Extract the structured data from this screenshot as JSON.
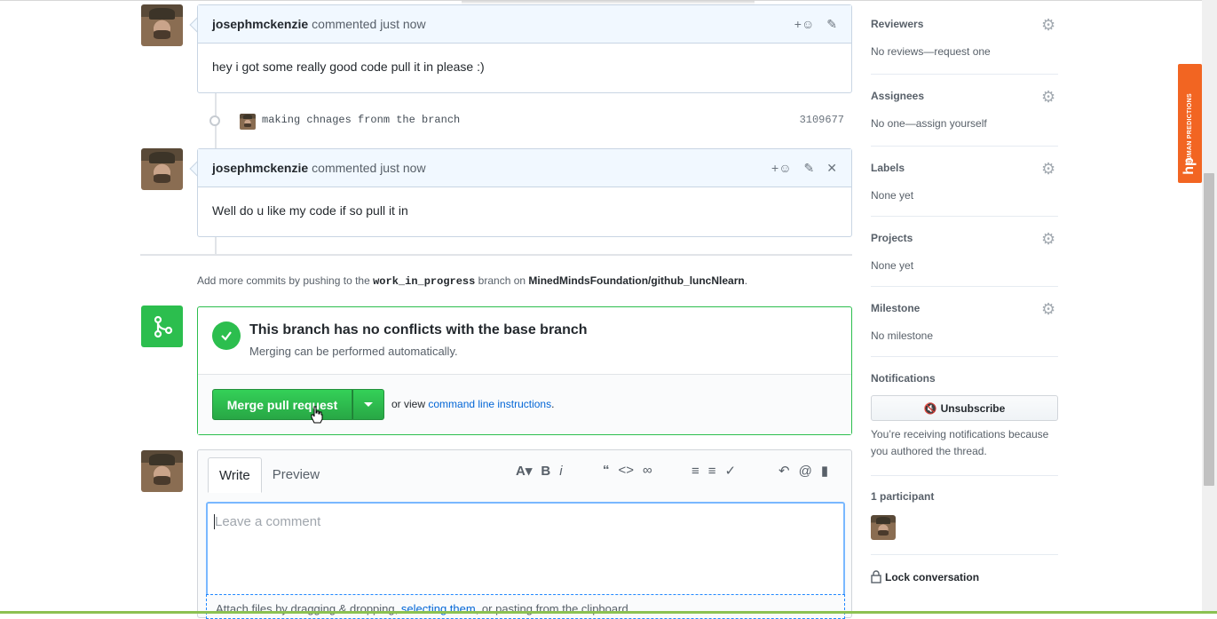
{
  "comments": [
    {
      "author": "josephmckenzie",
      "meta": "commented just now",
      "body": "hey i got some really good code pull it in please :)"
    },
    {
      "author": "josephmckenzie",
      "meta": "commented just now",
      "body": "Well do u like my code if so pull it in"
    }
  ],
  "commit": {
    "message": "making chnages fronm the branch",
    "sha": "3109677"
  },
  "addmore": {
    "prefix": "Add more commits by pushing to the",
    "branch": "work_in_progress",
    "middle": "branch on",
    "repo": "MinedMindsFoundation/github_luncNlearn",
    "suffix": "."
  },
  "merge": {
    "title": "This branch has no conflicts with the base branch",
    "subtitle": "Merging can be performed automatically.",
    "button": "Merge pull request",
    "or_view": "or view",
    "link": "command line instructions",
    "link_suffix": "."
  },
  "editor": {
    "tab_write": "Write",
    "tab_preview": "Preview",
    "placeholder": "Leave a comment",
    "attach_prefix": "Attach files by dragging & dropping,",
    "attach_link": "selecting them",
    "attach_suffix": ", or pasting from the clipboard."
  },
  "sidebar": {
    "reviewers": {
      "title": "Reviewers",
      "value": "No reviews—request one"
    },
    "assignees": {
      "title": "Assignees",
      "value": "No one—assign yourself"
    },
    "labels": {
      "title": "Labels",
      "value": "None yet"
    },
    "projects": {
      "title": "Projects",
      "value": "None yet"
    },
    "milestone": {
      "title": "Milestone",
      "value": "No milestone"
    },
    "notifications": {
      "title": "Notifications",
      "button": "Unsubscribe",
      "text": "You’re receiving notifications because you authored the thread."
    },
    "participants": {
      "title": "1 participant"
    },
    "lock": "Lock conversation"
  },
  "overlay": {
    "brand_small": "HUMAN PREDICTIONS",
    "brand_logo": "hp"
  },
  "colors": {
    "accent_green": "#2cbe4e",
    "link_blue": "#0366d6",
    "brand_orange": "#f26522"
  }
}
